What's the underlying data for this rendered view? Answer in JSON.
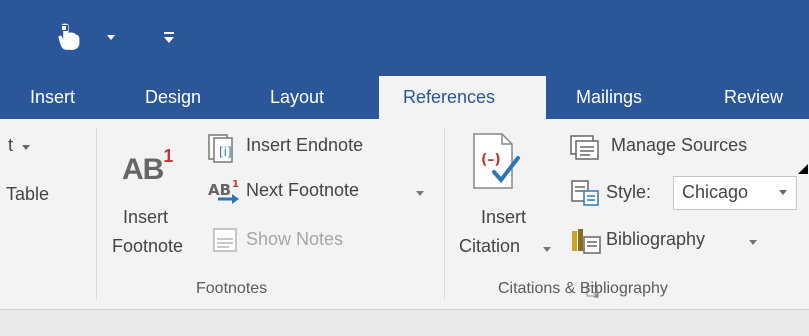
{
  "titlebar": {
    "qat_icons": [
      "touch-mode-icon",
      "dropdown-arrow-icon",
      "customize-qat-icon"
    ]
  },
  "tabs": [
    {
      "label": "Insert",
      "active": false
    },
    {
      "label": "Design",
      "active": false
    },
    {
      "label": "Layout",
      "active": false
    },
    {
      "label": "References",
      "active": true
    },
    {
      "label": "Mailings",
      "active": false
    },
    {
      "label": "Review",
      "active": false
    }
  ],
  "left_partial": {
    "top_label": "t",
    "table_label": "Table"
  },
  "footnotes": {
    "insert_footnote_line1": "Insert",
    "insert_footnote_line2": "Footnote",
    "big_icon_text": "AB",
    "big_icon_sup": "1",
    "insert_endnote": "Insert Endnote",
    "next_footnote": "Next Footnote",
    "show_notes": "Show Notes",
    "group_label": "Footnotes"
  },
  "citations": {
    "insert_citation_line1": "Insert",
    "insert_citation_line2": "Citation",
    "manage_sources": "Manage Sources",
    "style_label": "Style:",
    "style_value": "Chicago",
    "bibliography": "Bibliography",
    "group_label": "Citations & Bibliography"
  },
  "colors": {
    "brand_blue": "#2b579a",
    "ribbon_bg": "#f3f3f3",
    "accent_red": "#c0392b",
    "check_blue": "#2e75b6"
  }
}
